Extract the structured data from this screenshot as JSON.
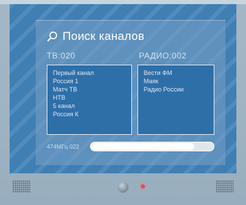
{
  "search": {
    "title": "Поиск каналов",
    "icon": "search-icon"
  },
  "tv": {
    "label": "ТВ:020",
    "channels": [
      "Первый канал",
      "Россия 1",
      "Матч ТВ",
      "НТВ",
      "5 канал",
      "Россия К"
    ]
  },
  "radio": {
    "label": "РАДИО:002",
    "channels": [
      "Вести ФМ",
      "Маяк",
      "Радио России"
    ]
  },
  "progress": {
    "label": "474МГц 022",
    "fraction": 0.85
  },
  "colors": {
    "screen": "#3f7fb4",
    "list_bg": "#2f6fa8",
    "power_led": "#e24a5a"
  }
}
